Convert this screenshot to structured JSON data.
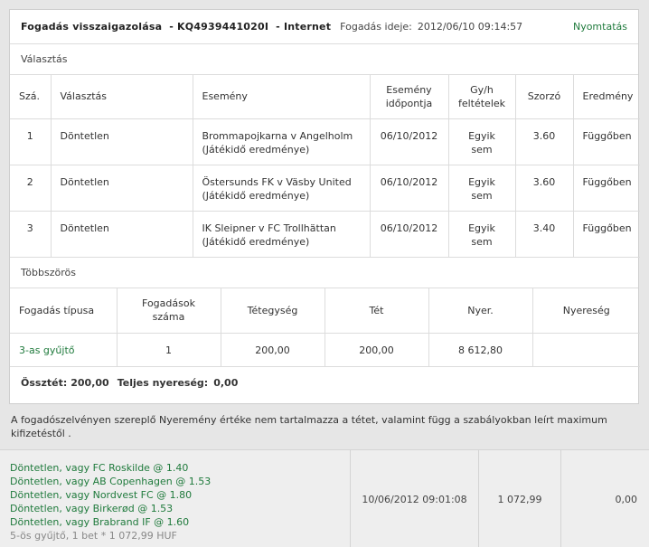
{
  "header": {
    "title": "Fogadás visszaigazolása",
    "bet_id": "KQ4939441020I",
    "channel": "Internet",
    "time_label": "Fogadás ideje:",
    "time_value": "2012/06/10 09:14:57",
    "print_label": "Nyomtatás"
  },
  "selections": {
    "section_title": "Választás",
    "columns": [
      "Szá.",
      "Választás",
      "Esemény",
      "Esemény időpontja",
      "Gy/h feltételek",
      "Szorzó",
      "Eredmény"
    ],
    "rows": [
      {
        "num": "1",
        "choice": "Döntetlen",
        "event": "Brommapojkarna v Angelholm",
        "event_sub": "(Játékidő eredménye)",
        "date": "06/10/2012",
        "cond": "Egyik sem",
        "odds": "3.60",
        "result": "Függőben"
      },
      {
        "num": "2",
        "choice": "Döntetlen",
        "event": "Östersunds FK v Väsby United",
        "event_sub": "(Játékidő eredménye)",
        "date": "06/10/2012",
        "cond": "Egyik sem",
        "odds": "3.60",
        "result": "Függőben"
      },
      {
        "num": "3",
        "choice": "Döntetlen",
        "event": "IK Sleipner v FC Trollhättan",
        "event_sub": "(Játékidő eredménye)",
        "date": "06/10/2012",
        "cond": "Egyik sem",
        "odds": "3.40",
        "result": "Függőben"
      }
    ]
  },
  "multiple": {
    "section_title": "Többszörös",
    "columns": [
      "Fogadás típusa",
      "Fogadások száma",
      "Tétegység",
      "Tét",
      "Nyer.",
      "Nyereség"
    ],
    "row": {
      "type": "3-as gyűjtő",
      "count": "1",
      "unit": "200,00",
      "stake": "200,00",
      "win": "8 612,80",
      "profit": ""
    }
  },
  "totals": {
    "stake_label": "Össztét:",
    "stake_value": "200,00",
    "profit_label": "Teljes nyereség:",
    "profit_value": "0,00"
  },
  "note": "A fogadószelvényen szereplő Nyeremény értéke nem tartalmazza a tétet, valamint függ a szabályokban leírt maximum kifizetéstől .",
  "history": {
    "picks": [
      "Döntetlen, vagy FC Roskilde @ 1.40",
      "Döntetlen, vagy AB Copenhagen @ 1.53",
      "Döntetlen, vagy Nordvest FC @ 1.80",
      "Döntetlen, vagy Birkerød @ 1.53",
      "Döntetlen, vagy Brabrand IF @ 1.60"
    ],
    "summary": "5-ös gyűjtő, 1 bet * 1 072,99 HUF",
    "datetime": "10/06/2012 09:01:08",
    "amount": "1 072,99",
    "result": "0,00"
  },
  "colors": {
    "link": "#1f7a3c",
    "panel_bg": "#ffffff",
    "page_bg": "#e6e6e6"
  }
}
